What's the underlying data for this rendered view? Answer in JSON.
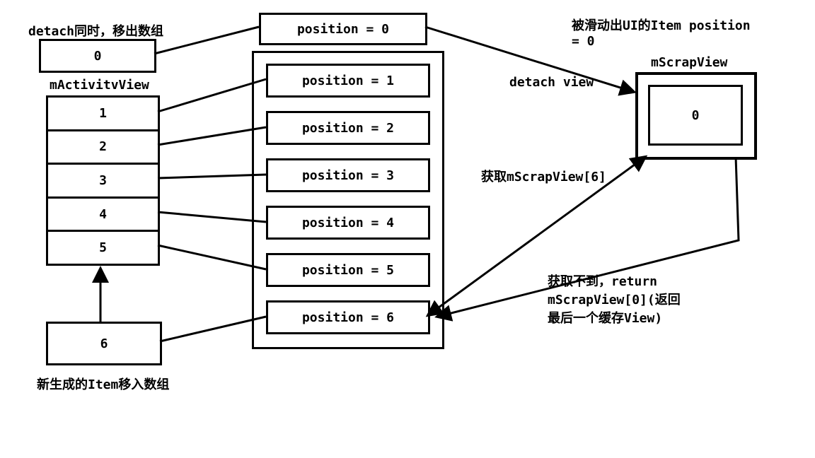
{
  "labels": {
    "detach_note": "detach同时，移出数组",
    "activity_view": "mActivitvView",
    "new_item_note": "新生成的Item移入数组",
    "scrolled_out_note": "被滑动出UI的Item position\n= 0",
    "scrap_view_title": "mScrapView",
    "detach_view": "detach view",
    "get_scrap6": "获取mScrapView[6]",
    "get_fail_note": "获取不到，return\nmScrapView[0](返回\n最后一个缓存View)"
  },
  "removed_item": "0",
  "activity_items": [
    "1",
    "2",
    "3",
    "4",
    "5"
  ],
  "new_item": "6",
  "positions": [
    "position = 0",
    "position = 1",
    "position = 2",
    "position = 3",
    "position = 4",
    "position = 5",
    "position = 6"
  ],
  "scrap_value": "0"
}
